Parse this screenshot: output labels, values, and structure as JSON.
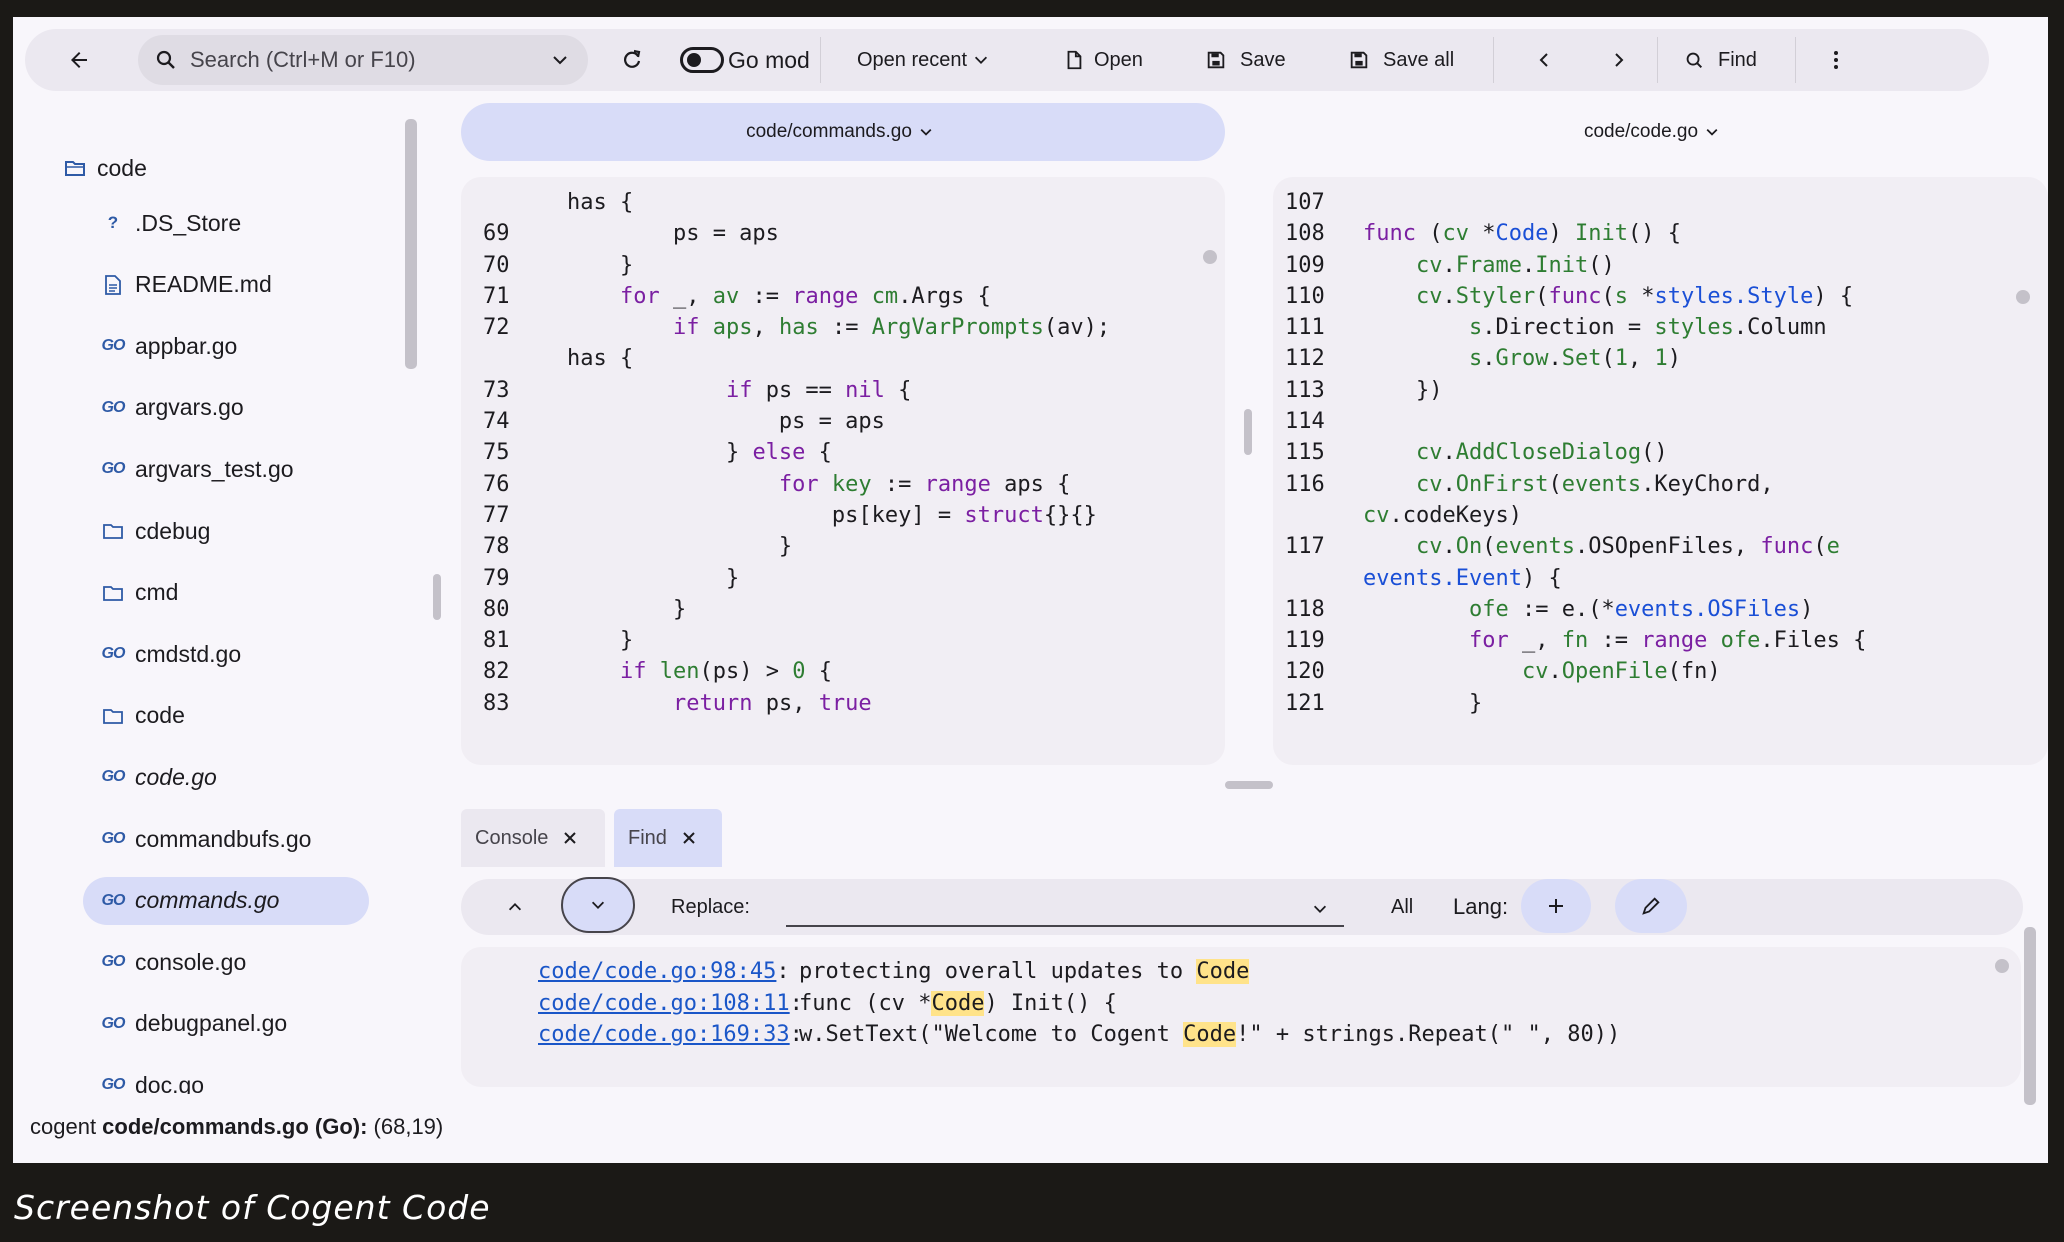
{
  "caption": "Screenshot of Cogent Code",
  "toolbar": {
    "search_placeholder": "Search (Ctrl+M or F10)",
    "go_mod": "Go mod",
    "open_recent": "Open recent",
    "open": "Open",
    "save": "Save",
    "save_all": "Save all",
    "find": "Find"
  },
  "sidebar": {
    "root": "code",
    "items": [
      {
        "label": ".DS_Store",
        "icon": "question-icon"
      },
      {
        "label": "README.md",
        "icon": "document-icon"
      },
      {
        "label": "appbar.go",
        "icon": "go-icon"
      },
      {
        "label": "argvars.go",
        "icon": "go-icon"
      },
      {
        "label": "argvars_test.go",
        "icon": "go-icon"
      },
      {
        "label": "cdebug",
        "icon": "folder-icon"
      },
      {
        "label": "cmd",
        "icon": "folder-icon"
      },
      {
        "label": "cmdstd.go",
        "icon": "go-icon"
      },
      {
        "label": "code",
        "icon": "folder-icon"
      },
      {
        "label": "code.go",
        "icon": "go-icon"
      },
      {
        "label": "commandbufs.go",
        "icon": "go-icon"
      },
      {
        "label": "commands.go",
        "icon": "go-icon"
      },
      {
        "label": "console.go",
        "icon": "go-icon"
      },
      {
        "label": "debugpanel.go",
        "icon": "go-icon"
      },
      {
        "label": "doc.go",
        "icon": "go-icon"
      }
    ]
  },
  "editor": {
    "left_tab": "code/commands.go",
    "right_tab": "code/code.go",
    "left_first_line": "has {",
    "left_lines": [
      "69",
      "70",
      "71",
      "72",
      "",
      "73",
      "74",
      "75",
      "76",
      "77",
      "78",
      "79",
      "80",
      "81",
      "82",
      "83"
    ],
    "right_lines": [
      "107",
      "108",
      "109",
      "110",
      "111",
      "112",
      "113",
      "114",
      "115",
      "116",
      "",
      "117",
      "",
      "118",
      "119",
      "120",
      "121"
    ]
  },
  "bottom": {
    "console_tab": "Console",
    "find_tab": "Find",
    "replace_label": "Replace:",
    "all_label": "All",
    "lang_label": "Lang:",
    "results": [
      {
        "loc": "code/code.go:98:45",
        "pre": "protecting overall updates to ",
        "match": "Code",
        "post": ""
      },
      {
        "loc": "code/code.go:108:11",
        "pre": "func (cv *",
        "match": "Code",
        "post": ") Init() {"
      },
      {
        "loc": "code/code.go:169:33",
        "pre": "w.SetText(\"Welcome to Cogent ",
        "match": "Code",
        "post": "!\" + strings.Repeat(\" \", 80))"
      }
    ]
  },
  "status": {
    "prefix": "cogent ",
    "file": "code/commands.go (Go):",
    "pos": " (68,19)"
  }
}
